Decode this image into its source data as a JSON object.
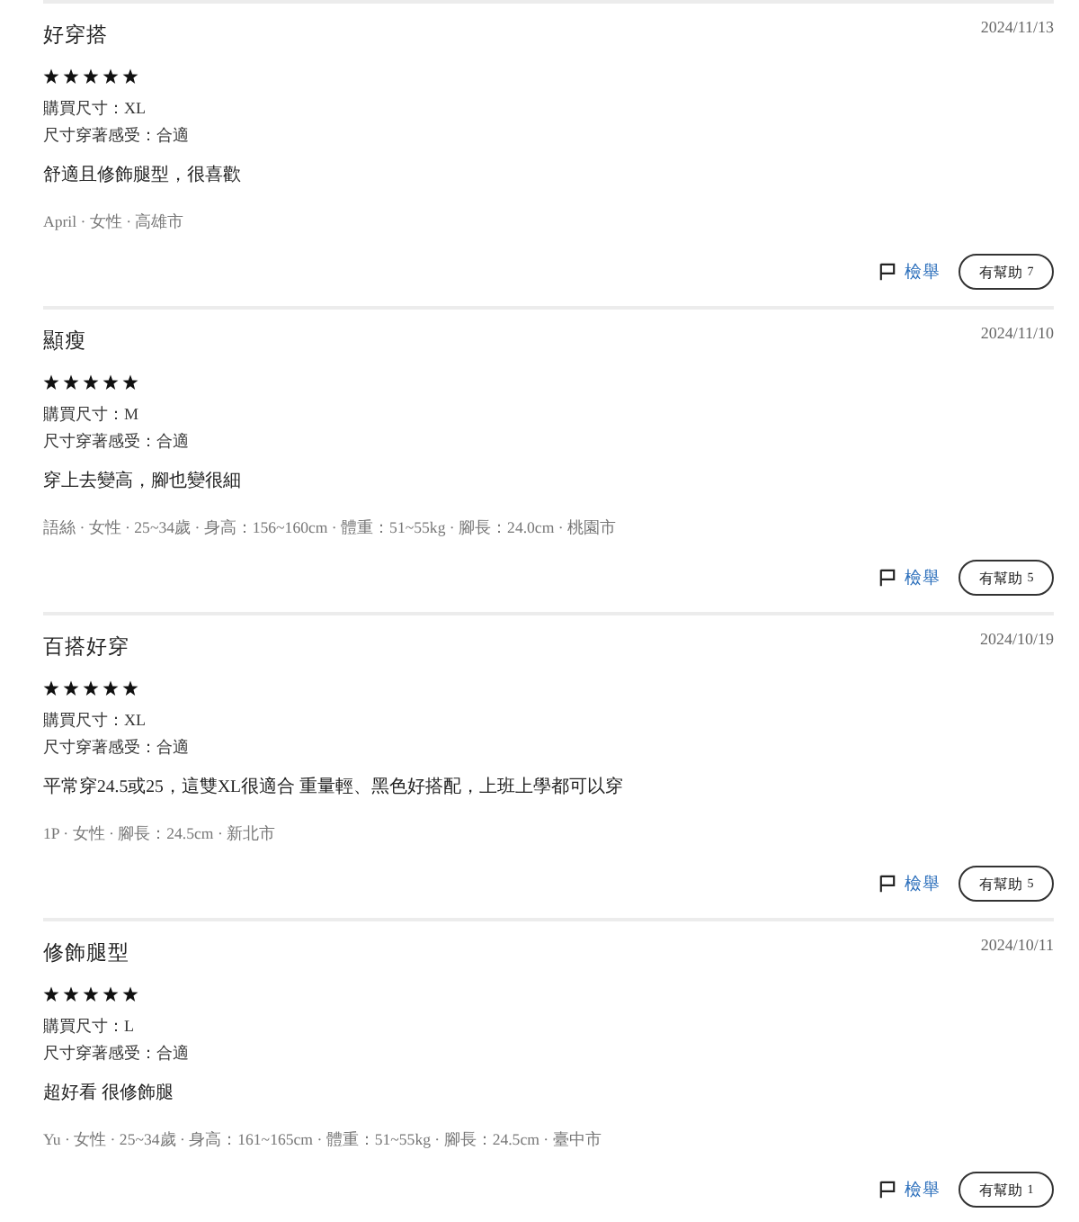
{
  "reviews": [
    {
      "title": "好穿搭",
      "date": "2024/11/13",
      "stars": 5,
      "size": "購買尺寸：XL",
      "fit": "尺寸穿著感受：合適",
      "body": "舒適且修飾腿型，很喜歡",
      "meta": "April · 女性 · 高雄市",
      "report": "檢舉",
      "helpful": {
        "label": "有幫助",
        "count": "7"
      }
    },
    {
      "title": "顯瘦",
      "date": "2024/11/10",
      "stars": 5,
      "size": "購買尺寸：M",
      "fit": "尺寸穿著感受：合適",
      "body": "穿上去變高，腳也變很細",
      "meta": "語絲 · 女性 · 25~34歲 · 身高：156~160cm · 體重：51~55kg · 腳長：24.0cm · 桃園市",
      "report": "檢舉",
      "helpful": {
        "label": "有幫助",
        "count": "5"
      }
    },
    {
      "title": "百搭好穿",
      "date": "2024/10/19",
      "stars": 5,
      "size": "購買尺寸：XL",
      "fit": "尺寸穿著感受：合適",
      "body": "平常穿24.5或25，這雙XL很適合 重量輕、黑色好搭配，上班上學都可以穿",
      "meta": "1P · 女性 · 腳長：24.5cm · 新北市",
      "report": "檢舉",
      "helpful": {
        "label": "有幫助",
        "count": "5"
      }
    },
    {
      "title": "修飾腿型",
      "date": "2024/10/11",
      "stars": 5,
      "size": "購買尺寸：L",
      "fit": "尺寸穿著感受：合適",
      "body": "超好看 很修飾腿",
      "meta": "Yu · 女性 · 25~34歲 · 身高：161~165cm · 體重：51~55kg · 腳長：24.5cm · 臺中市",
      "report": "檢舉",
      "helpful": {
        "label": "有幫助",
        "count": "1"
      }
    }
  ]
}
